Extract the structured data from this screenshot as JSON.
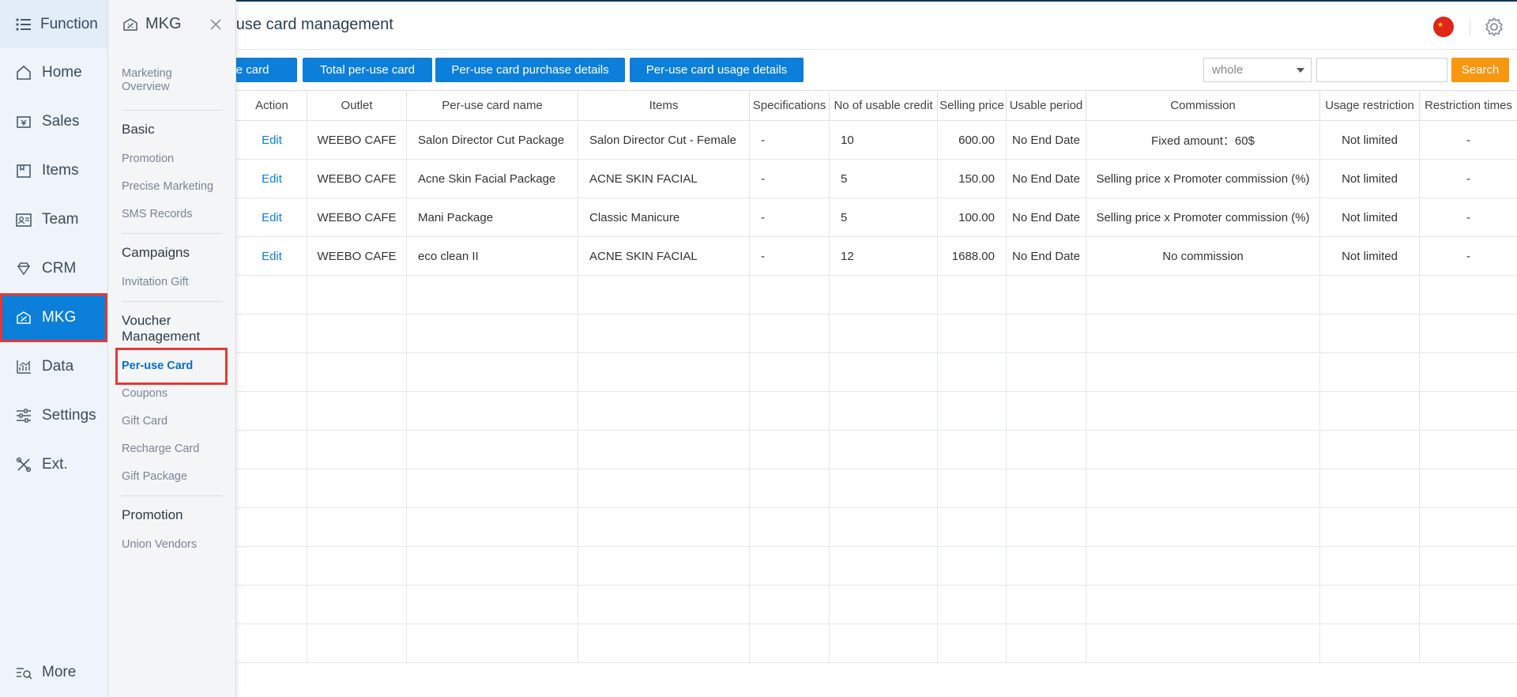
{
  "rail": {
    "header": "Function",
    "items": [
      {
        "label": "Home",
        "icon": "home-icon"
      },
      {
        "label": "Sales",
        "icon": "sales-icon"
      },
      {
        "label": "Items",
        "icon": "items-icon"
      },
      {
        "label": "Team",
        "icon": "team-icon"
      },
      {
        "label": "CRM",
        "icon": "diamond-icon"
      },
      {
        "label": "MKG",
        "icon": "marketing-icon"
      },
      {
        "label": "Data",
        "icon": "chart-icon"
      },
      {
        "label": "Settings",
        "icon": "sliders-icon"
      },
      {
        "label": "Ext.",
        "icon": "tools-icon"
      }
    ],
    "more": "More"
  },
  "submenu": {
    "title": "MKG",
    "overview": "Marketing Overview",
    "groups": {
      "basic": {
        "title": "Basic",
        "links": [
          "Promotion",
          "Precise Marketing",
          "SMS Records"
        ]
      },
      "campaigns": {
        "title": "Campaigns",
        "links": [
          "Invitation Gift"
        ]
      },
      "voucher": {
        "title": "Voucher Management",
        "links": [
          "Per-use Card",
          "Coupons",
          "Gift Card",
          "Recharge Card",
          "Gift Package"
        ]
      },
      "promotion": {
        "title": "Promotion",
        "links": [
          "Union Vendors"
        ]
      }
    }
  },
  "header": {
    "title": "Per-use card management"
  },
  "toolbar": {
    "btn1": "Per-use card",
    "btn2": "Total per-use card",
    "btn3": "Per-use card purchase details",
    "btn4": "Per-use card usage details",
    "select_value": "whole",
    "search_placeholder": "",
    "search_label": "Search"
  },
  "table": {
    "headers": [
      "Action",
      "Outlet",
      "Per-use card name",
      "Items",
      "Specifications",
      "No of usable credit",
      "Selling price",
      "Usable period",
      "Commission",
      "Usage restriction",
      "Restriction times"
    ],
    "rows": [
      [
        "Edit",
        "WEEBO CAFE",
        "Salon Director Cut Package",
        "Salon Director Cut - Female",
        "-",
        "10",
        "600.00",
        "No End Date",
        "Fixed amount：60$",
        "Not limited",
        "-"
      ],
      [
        "Edit",
        "WEEBO CAFE",
        "Acne Skin Facial Package",
        "ACNE SKIN FACIAL",
        "-",
        "5",
        "150.00",
        "No End Date",
        "Selling price x Promoter commission (%)",
        "Not limited",
        "-"
      ],
      [
        "Edit",
        "WEEBO CAFE",
        "Mani Package",
        "Classic Manicure",
        "-",
        "5",
        "100.00",
        "No End Date",
        "Selling price x Promoter commission (%)",
        "Not limited",
        "-"
      ],
      [
        "Edit",
        "WEEBO CAFE",
        "eco clean II",
        "ACNE SKIN FACIAL",
        "-",
        "12",
        "1688.00",
        "No End Date",
        "No commission",
        "Not limited",
        "-"
      ]
    ]
  },
  "colors": {
    "primary": "#0b7fd9",
    "search": "#f7960f",
    "highlight": "#e53935"
  }
}
